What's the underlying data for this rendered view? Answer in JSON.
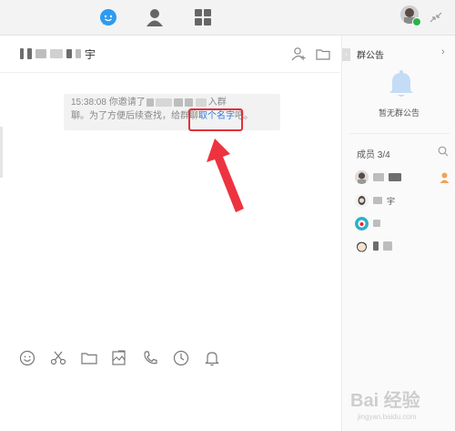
{
  "chat": {
    "title_suffix": "宇",
    "timestamp": "15:38",
    "system_message": {
      "line1_prefix": "15:38:08 你邀请了",
      "line1_suffix": "入群",
      "line2_prefix": "聊。为了方便后续查找，给群聊",
      "link": "取个名字",
      "line2_suffix": "吧。"
    }
  },
  "right_panel": {
    "notice_title": "群公告",
    "no_notice": "暂无群公告",
    "members_label": "成员 3/4",
    "members": [
      {
        "name": "",
        "owner": true
      },
      {
        "name": "宇",
        "owner": false
      },
      {
        "name": "",
        "owner": false
      },
      {
        "name": "",
        "owner": false
      }
    ]
  },
  "watermark": {
    "text": "Bai 经验",
    "url": "jingyan.baidu.com"
  },
  "colors": {
    "accent_blue": "#2d9bf0",
    "highlight_red": "#e2303a",
    "link_blue": "#2d7ad8",
    "online_green": "#2bb24c"
  }
}
